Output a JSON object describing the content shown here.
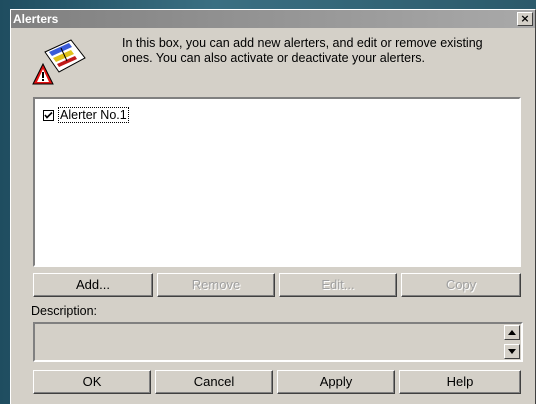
{
  "window": {
    "title": "Alerters",
    "close_glyph": "×"
  },
  "intro": {
    "icon": "alert-document-icon",
    "text": "In this box, you can add new alerters, and edit or remove existing ones. You can also activate or deactivate your alerters."
  },
  "alerters": [
    {
      "label": "Alerter No.1",
      "checked": true
    }
  ],
  "list_buttons": {
    "add": "Add...",
    "remove": "Remove",
    "edit": "Edit...",
    "copy": "Copy"
  },
  "description": {
    "label": "Description:",
    "value": ""
  },
  "footer_buttons": {
    "ok": "OK",
    "cancel": "Cancel",
    "apply": "Apply",
    "help": "Help"
  },
  "colors": {
    "dialog_bg": "#d4d0c8",
    "titlebar_start": "#808080",
    "titlebar_end": "#a9a9a9",
    "disabled_text": "#a0a0a0"
  }
}
